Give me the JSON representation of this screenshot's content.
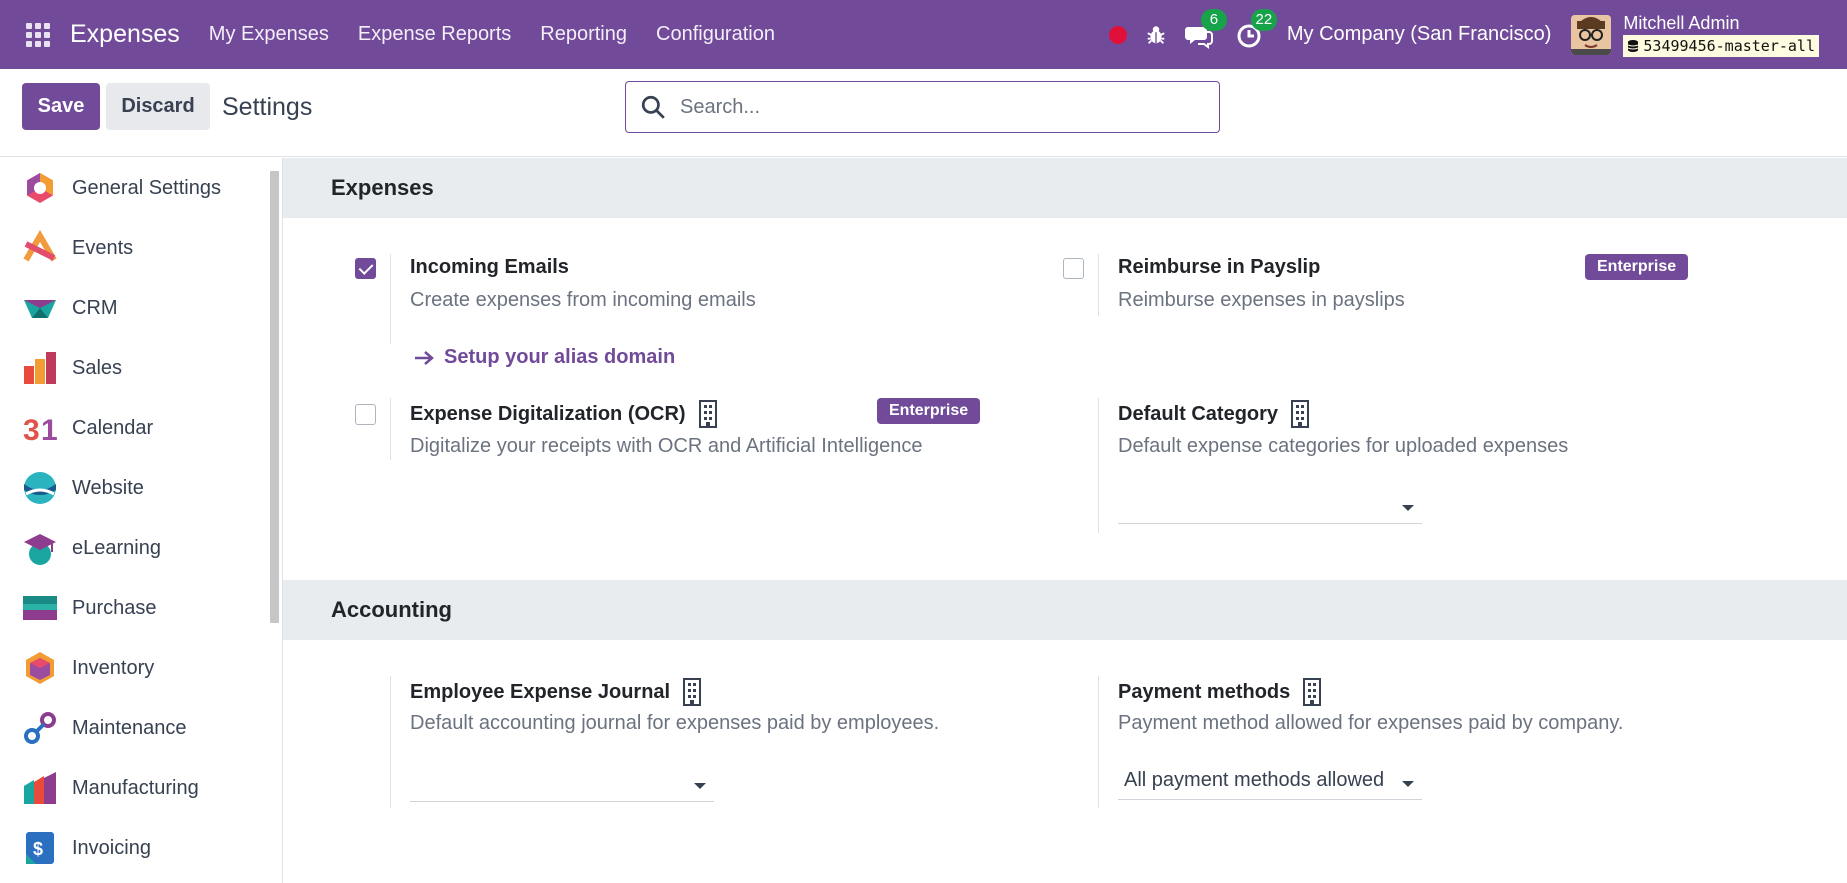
{
  "navbar": {
    "brand": "Expenses",
    "menu": [
      "My Expenses",
      "Expense Reports",
      "Reporting",
      "Configuration"
    ],
    "messages_count": "6",
    "activities_count": "22",
    "company": "My Company (San Francisco)",
    "user_name": "Mitchell Admin",
    "database": "53499456-master-all",
    "accent": "#714b99"
  },
  "control": {
    "save_label": "Save",
    "discard_label": "Discard",
    "title": "Settings",
    "search_placeholder": "Search..."
  },
  "sidebar": {
    "items": [
      {
        "label": "General Settings",
        "icon": "general-settings-icon"
      },
      {
        "label": "Events",
        "icon": "events-icon"
      },
      {
        "label": "CRM",
        "icon": "crm-icon"
      },
      {
        "label": "Sales",
        "icon": "sales-icon"
      },
      {
        "label": "Calendar",
        "icon": "calendar-icon"
      },
      {
        "label": "Website",
        "icon": "website-icon"
      },
      {
        "label": "eLearning",
        "icon": "elearning-icon"
      },
      {
        "label": "Purchase",
        "icon": "purchase-icon"
      },
      {
        "label": "Inventory",
        "icon": "inventory-icon"
      },
      {
        "label": "Maintenance",
        "icon": "maintenance-icon"
      },
      {
        "label": "Manufacturing",
        "icon": "manufacturing-icon"
      },
      {
        "label": "Invoicing",
        "icon": "invoicing-icon"
      }
    ]
  },
  "expenses": {
    "heading": "Expenses",
    "incoming_emails": {
      "title": "Incoming Emails",
      "desc": "Create expenses from incoming emails",
      "checked": true,
      "link": "Setup your alias domain"
    },
    "reimburse_payslip": {
      "title": "Reimburse in Payslip",
      "desc": "Reimburse expenses in payslips",
      "checked": false,
      "badge": "Enterprise"
    },
    "ocr": {
      "title": "Expense Digitalization (OCR)",
      "desc": "Digitalize your receipts with OCR and Artificial Intelligence",
      "checked": false,
      "badge": "Enterprise"
    },
    "default_category": {
      "title": "Default Category",
      "desc": "Default expense categories for uploaded expenses",
      "value": ""
    }
  },
  "accounting": {
    "heading": "Accounting",
    "journal": {
      "title": "Employee Expense Journal",
      "desc": "Default accounting journal for expenses paid by employees.",
      "value": ""
    },
    "payment_methods": {
      "title": "Payment methods",
      "desc": "Payment method allowed for expenses paid by company.",
      "value": "All payment methods allowed"
    }
  }
}
